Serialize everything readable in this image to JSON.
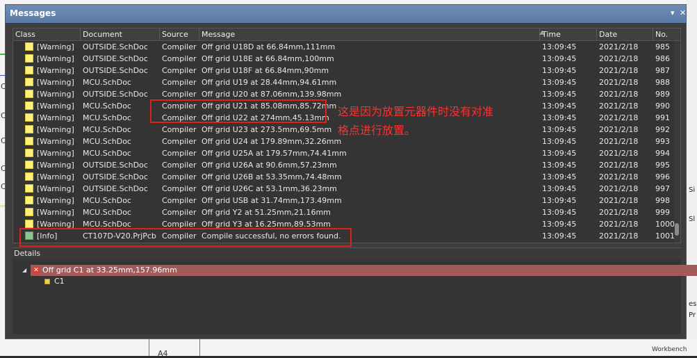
{
  "panel": {
    "title": "Messages",
    "pin_icon": "▾",
    "close_icon": "✕"
  },
  "columns": [
    "Class",
    "Document",
    "Source",
    "Message",
    "Time",
    "Date",
    "No."
  ],
  "rows": [
    {
      "cls": "[Warning]",
      "doc": "OUTSIDE.SchDoc",
      "src": "Compiler",
      "msg": "Off grid U18D at 66.84mm,111mm",
      "time": "13:09:45",
      "date": "2021/2/18",
      "no": "985",
      "type": "warn"
    },
    {
      "cls": "[Warning]",
      "doc": "OUTSIDE.SchDoc",
      "src": "Compiler",
      "msg": "Off grid U18E at 66.84mm,100mm",
      "time": "13:09:45",
      "date": "2021/2/18",
      "no": "986",
      "type": "warn"
    },
    {
      "cls": "[Warning]",
      "doc": "OUTSIDE.SchDoc",
      "src": "Compiler",
      "msg": "Off grid U18F at 66.84mm,90mm",
      "time": "13:09:45",
      "date": "2021/2/18",
      "no": "987",
      "type": "warn"
    },
    {
      "cls": "[Warning]",
      "doc": "MCU.SchDoc",
      "src": "Compiler",
      "msg": "Off grid U19 at 28.44mm,94.61mm",
      "time": "13:09:45",
      "date": "2021/2/18",
      "no": "988",
      "type": "warn"
    },
    {
      "cls": "[Warning]",
      "doc": "OUTSIDE.SchDoc",
      "src": "Compiler",
      "msg": "Off grid U20 at 87.06mm,139.98mm",
      "time": "13:09:45",
      "date": "2021/2/18",
      "no": "989",
      "type": "warn"
    },
    {
      "cls": "[Warning]",
      "doc": "MCU.SchDoc",
      "src": "Compiler",
      "msg": "Off grid U21 at 85.08mm,85.72mm",
      "time": "13:09:45",
      "date": "2021/2/18",
      "no": "990",
      "type": "warn"
    },
    {
      "cls": "[Warning]",
      "doc": "MCU.SchDoc",
      "src": "Compiler",
      "msg": "Off grid U22 at 274mm,45.13mm",
      "time": "13:09:45",
      "date": "2021/2/18",
      "no": "991",
      "type": "warn"
    },
    {
      "cls": "[Warning]",
      "doc": "MCU.SchDoc",
      "src": "Compiler",
      "msg": "Off grid U23 at 273.5mm,69.5mm",
      "time": "13:09:45",
      "date": "2021/2/18",
      "no": "992",
      "type": "warn"
    },
    {
      "cls": "[Warning]",
      "doc": "MCU.SchDoc",
      "src": "Compiler",
      "msg": "Off grid U24 at 179.89mm,32.26mm",
      "time": "13:09:45",
      "date": "2021/2/18",
      "no": "993",
      "type": "warn"
    },
    {
      "cls": "[Warning]",
      "doc": "MCU.SchDoc",
      "src": "Compiler",
      "msg": "Off grid U25A at 179.57mm,74.41mm",
      "time": "13:09:45",
      "date": "2021/2/18",
      "no": "994",
      "type": "warn"
    },
    {
      "cls": "[Warning]",
      "doc": "OUTSIDE.SchDoc",
      "src": "Compiler",
      "msg": "Off grid U26A at 90.6mm,57.23mm",
      "time": "13:09:45",
      "date": "2021/2/18",
      "no": "995",
      "type": "warn"
    },
    {
      "cls": "[Warning]",
      "doc": "OUTSIDE.SchDoc",
      "src": "Compiler",
      "msg": "Off grid U26B at 53.35mm,74.48mm",
      "time": "13:09:45",
      "date": "2021/2/18",
      "no": "996",
      "type": "warn"
    },
    {
      "cls": "[Warning]",
      "doc": "OUTSIDE.SchDoc",
      "src": "Compiler",
      "msg": "Off grid U26C at 53.1mm,36.23mm",
      "time": "13:09:45",
      "date": "2021/2/18",
      "no": "997",
      "type": "warn"
    },
    {
      "cls": "[Warning]",
      "doc": "MCU.SchDoc",
      "src": "Compiler",
      "msg": "Off grid USB at 31.74mm,173.49mm",
      "time": "13:09:45",
      "date": "2021/2/18",
      "no": "998",
      "type": "warn"
    },
    {
      "cls": "[Warning]",
      "doc": "MCU.SchDoc",
      "src": "Compiler",
      "msg": "Off grid Y2 at 51.25mm,21.16mm",
      "time": "13:09:45",
      "date": "2021/2/18",
      "no": "999",
      "type": "warn"
    },
    {
      "cls": "[Warning]",
      "doc": "MCU.SchDoc",
      "src": "Compiler",
      "msg": "Off grid Y3 at 16.25mm,89.53mm",
      "time": "13:09:45",
      "date": "2021/2/18",
      "no": "1000",
      "type": "warn"
    },
    {
      "cls": "[Info]",
      "doc": "CT107D-V20.PrjPcb",
      "src": "Compiler",
      "msg": "Compile successful, no errors found.",
      "time": "13:09:45",
      "date": "2021/2/18",
      "no": "1001",
      "type": "info"
    }
  ],
  "annotation": {
    "line1": "这是因为放置元器件时没有对准",
    "line2": "格点进行放置。"
  },
  "details": {
    "header": "Details",
    "selected": "Off grid C1 at 33.25mm,157.96mm",
    "child": "C1"
  },
  "background": {
    "left_chars": [
      "C",
      "C",
      "C",
      "C",
      "C"
    ],
    "right_char1": "Si",
    "right_char2": "Sl",
    "right_char3": "es",
    "right_char4": "Pr",
    "sheet_size": "A4",
    "bottom_right": "Workbench"
  }
}
